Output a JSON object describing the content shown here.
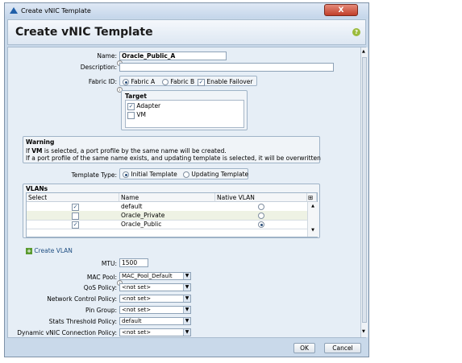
{
  "window": {
    "title": "Create vNIC Template",
    "close_label": "X"
  },
  "header": {
    "title": "Create vNIC Template",
    "help_label": "?"
  },
  "form": {
    "name_label": "Name:",
    "name_value": "Oracle_Public_A",
    "description_label": "Description:",
    "description_value": "",
    "fabric_label": "Fabric ID:",
    "fabric_a": "Fabric A",
    "fabric_b": "Fabric B",
    "enable_failover": "Enable Failover",
    "target_title": "Target",
    "target_adapter": "Adapter",
    "target_vm": "VM"
  },
  "warning": {
    "title": "Warning",
    "line1_prefix": "If ",
    "line1_bold": "VM",
    "line1_suffix": " is selected, a port profile by the same name will be created.",
    "line2": "If a port profile of the same name exists, and updating template is selected, it will be overwritten"
  },
  "template_type": {
    "label": "Template Type:",
    "initial": "Initial Template",
    "updating": "Updating Template"
  },
  "vlans": {
    "title": "VLANs",
    "columns": [
      "Select",
      "Name",
      "Native VLAN"
    ],
    "rows": [
      {
        "name": "default",
        "selected": true,
        "native": false
      },
      {
        "name": "Oracle_Private",
        "selected": false,
        "native": false
      },
      {
        "name": "Oracle_Public",
        "selected": true,
        "native": true
      }
    ]
  },
  "create_vlan": "Create VLAN",
  "mtu": {
    "label": "MTU:",
    "value": "1500"
  },
  "policies": [
    {
      "label": "MAC Pool:",
      "value": "MAC_Pool_Default"
    },
    {
      "label": "QoS Policy:",
      "value": "<not set>"
    },
    {
      "label": "Network Control Policy:",
      "value": "<not set>"
    },
    {
      "label": "Pin Group:",
      "value": "<not set>"
    },
    {
      "label": "Stats Threshold Policy:",
      "value": "default"
    },
    {
      "label": "Dynamic vNIC Connection Policy:",
      "value": "<not set>"
    }
  ],
  "buttons": {
    "ok": "OK",
    "cancel": "Cancel"
  },
  "colors": {
    "accent": "#2b4f7a",
    "window_bg": "#c9d9ea",
    "close": "#c1402b"
  }
}
